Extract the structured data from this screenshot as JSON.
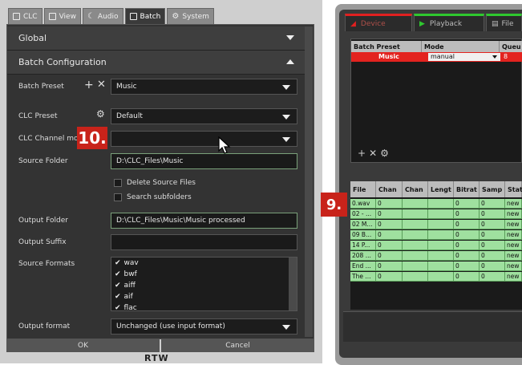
{
  "tabs": [
    {
      "label": "CLC",
      "icon": "clc-icon"
    },
    {
      "label": "View",
      "icon": "view-icon"
    },
    {
      "label": "Audio",
      "icon": "audio-icon"
    },
    {
      "label": "Batch",
      "icon": "batch-icon"
    },
    {
      "label": "System",
      "icon": "gear-icon"
    }
  ],
  "active_tab": "Batch",
  "sections": {
    "global": "Global",
    "batch_config": "Batch Configuration"
  },
  "form": {
    "batch_preset_label": "Batch Preset",
    "batch_preset_value": "Music",
    "clc_preset_label": "CLC Preset",
    "clc_preset_value": "Default",
    "clc_channel_label": "CLC Channel mod",
    "clc_channel_value": "",
    "source_folder_label": "Source Folder",
    "source_folder_value": "D:\\CLC_Files\\Music",
    "delete_source_label": "Delete Source Files",
    "search_sub_label": "Search subfolders",
    "output_folder_label": "Output Folder",
    "output_folder_value": "D:\\CLC_Files\\Music\\Music processed",
    "output_suffix_label": "Output Suffix",
    "output_suffix_value": "",
    "source_formats_label": "Source Formats",
    "source_formats": [
      "wav",
      "bwf",
      "aiff",
      "aif",
      "flac"
    ],
    "output_format_label": "Output format",
    "output_format_value": "Unchanged (use input format)"
  },
  "buttons": {
    "ok": "OK",
    "cancel": "Cancel"
  },
  "brand": "RTW",
  "callouts": {
    "ten": "10.",
    "nine": "9."
  },
  "device": {
    "tabs": [
      "Device",
      "Playback",
      "File"
    ],
    "batch_table": {
      "headers": [
        "Batch Preset",
        "Mode",
        "Queu"
      ],
      "row": {
        "preset": "Music",
        "mode": "manual",
        "queue": "8"
      }
    },
    "file_table": {
      "headers": [
        "File",
        "Chan",
        "Chan",
        "Lengt",
        "Bitrat",
        "Samp",
        "Stat"
      ],
      "rows": [
        [
          "0.wav",
          "0",
          "",
          "",
          "0",
          "0",
          "new"
        ],
        [
          "02 - ...",
          "0",
          "",
          "",
          "0",
          "0",
          "new"
        ],
        [
          "02 M...",
          "0",
          "",
          "",
          "0",
          "0",
          "new"
        ],
        [
          "09 B...",
          "0",
          "",
          "",
          "0",
          "0",
          "new"
        ],
        [
          "14 P...",
          "0",
          "",
          "",
          "0",
          "0",
          "new"
        ],
        [
          "208 ...",
          "0",
          "",
          "",
          "0",
          "0",
          "new"
        ],
        [
          "End ...",
          "0",
          "",
          "",
          "0",
          "0",
          "new"
        ],
        [
          "The ...",
          "0",
          "",
          "",
          "0",
          "0",
          "new"
        ]
      ]
    }
  },
  "colors": {
    "callout": "#c8231a",
    "row_green": "#9fe09f",
    "accent_red": "#e02020"
  }
}
